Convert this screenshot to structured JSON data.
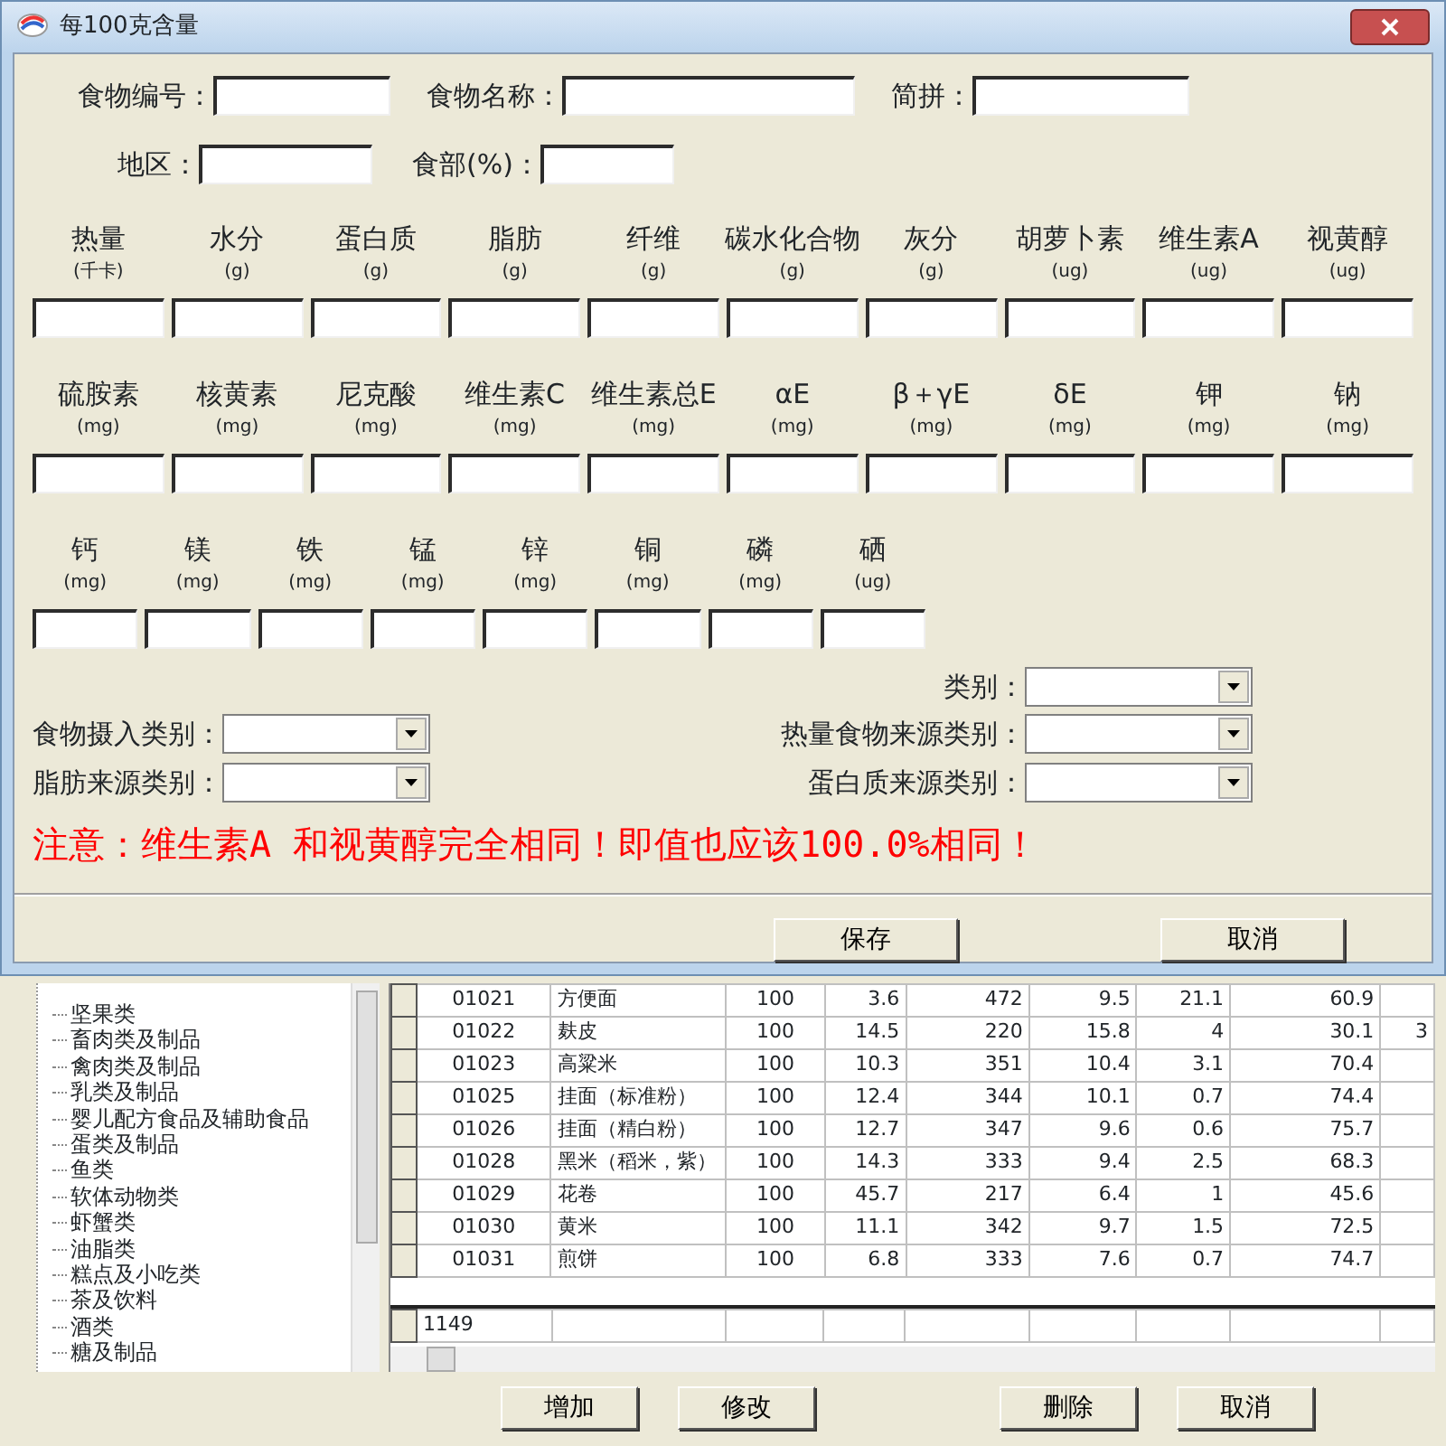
{
  "dialog": {
    "title": "每100克含量",
    "id_fields": [
      [
        {
          "label": "食物编号："
        },
        {
          "label": "食物名称："
        },
        {
          "label": "简拼："
        }
      ],
      [
        {
          "label": "地区："
        },
        {
          "label": "食部(%)："
        }
      ]
    ],
    "nutrient_rows": [
      [
        {
          "label": "热量",
          "unit": "(千卡)"
        },
        {
          "label": "水分",
          "unit": "(g)"
        },
        {
          "label": "蛋白质",
          "unit": "(g)"
        },
        {
          "label": "脂肪",
          "unit": "(g)"
        },
        {
          "label": "纤维",
          "unit": "(g)"
        },
        {
          "label": "碳水化合物",
          "unit": "(g)"
        },
        {
          "label": "灰分",
          "unit": "(g)"
        },
        {
          "label": "胡萝卜素",
          "unit": "(ug)"
        },
        {
          "label": "维生素A",
          "unit": "(ug)"
        },
        {
          "label": "视黄醇",
          "unit": "(ug)"
        }
      ],
      [
        {
          "label": "硫胺素",
          "unit": "(mg)"
        },
        {
          "label": "核黄素",
          "unit": "(mg)"
        },
        {
          "label": "尼克酸",
          "unit": "(mg)"
        },
        {
          "label": "维生素C",
          "unit": "(mg)"
        },
        {
          "label": "维生素总E",
          "unit": "(mg)"
        },
        {
          "label": "αE",
          "unit": "(mg)"
        },
        {
          "label": "β＋γE",
          "unit": "(mg)"
        },
        {
          "label": "δE",
          "unit": "(mg)"
        },
        {
          "label": "钾",
          "unit": "(mg)"
        },
        {
          "label": "钠",
          "unit": "(mg)"
        }
      ],
      [
        {
          "label": "钙",
          "unit": "(mg)"
        },
        {
          "label": "镁",
          "unit": "(mg)"
        },
        {
          "label": "铁",
          "unit": "(mg)"
        },
        {
          "label": "锰",
          "unit": "(mg)"
        },
        {
          "label": "锌",
          "unit": "(mg)"
        },
        {
          "label": "铜",
          "unit": "(mg)"
        },
        {
          "label": "磷",
          "unit": "(mg)"
        },
        {
          "label": "硒",
          "unit": "(ug)"
        }
      ]
    ],
    "category_selects": [
      [
        {
          "label": "类别："
        }
      ],
      [
        {
          "label": "食物摄入类别："
        },
        {
          "label": "热量食物来源类别："
        }
      ],
      [
        {
          "label": "脂肪来源类别："
        },
        {
          "label": "蛋白质来源类别："
        }
      ]
    ],
    "note": "注意：维生素A 和视黄醇完全相同！即值也应该100.0%相同！",
    "buttons": [
      "保存",
      "取消"
    ]
  },
  "background": {
    "tree_items": [
      "坚果类",
      "畜肉类及制品",
      "禽肉类及制品",
      "乳类及制品",
      "婴儿配方食品及辅助食品",
      "蛋类及制品",
      "鱼类",
      "软体动物类",
      "虾蟹类",
      "油脂类",
      "糕点及小吃类",
      "茶及饮料",
      "酒类",
      "糖及制品"
    ],
    "table": {
      "rows": [
        [
          "01021",
          "方便面",
          "100",
          "3.6",
          "472",
          "9.5",
          "21.1",
          "60.9"
        ],
        [
          "01022",
          "麸皮",
          "100",
          "14.5",
          "220",
          "15.8",
          "4",
          "30.1",
          "3"
        ],
        [
          "01023",
          "高粱米",
          "100",
          "10.3",
          "351",
          "10.4",
          "3.1",
          "70.4"
        ],
        [
          "01025",
          "挂面（标准粉）",
          "100",
          "12.4",
          "344",
          "10.1",
          "0.7",
          "74.4"
        ],
        [
          "01026",
          "挂面（精白粉）",
          "100",
          "12.7",
          "347",
          "9.6",
          "0.6",
          "75.7"
        ],
        [
          "01028",
          "黑米（稻米，紫）",
          "100",
          "14.3",
          "333",
          "9.4",
          "2.5",
          "68.3"
        ],
        [
          "01029",
          "花卷",
          "100",
          "45.7",
          "217",
          "6.4",
          "1",
          "45.6"
        ],
        [
          "01030",
          "黄米",
          "100",
          "11.1",
          "342",
          "9.7",
          "1.5",
          "72.5"
        ],
        [
          "01031",
          "煎饼",
          "100",
          "6.8",
          "333",
          "7.6",
          "0.7",
          "74.7"
        ]
      ],
      "footer": "1149"
    },
    "buttons": [
      "增加",
      "修改",
      "删除",
      "取消"
    ]
  }
}
